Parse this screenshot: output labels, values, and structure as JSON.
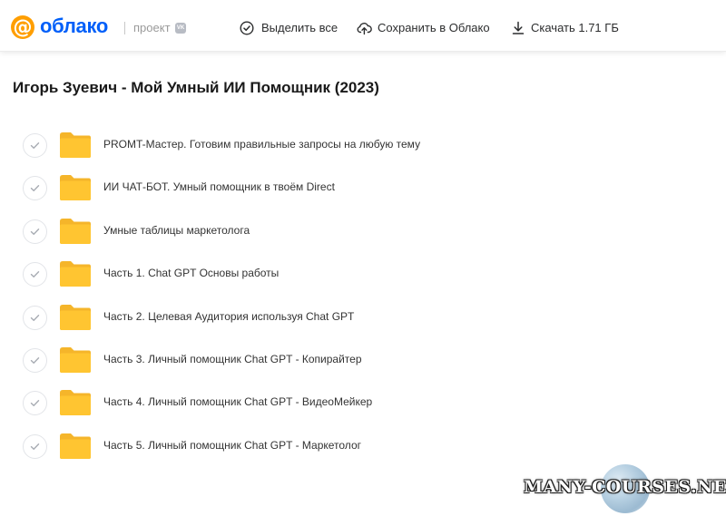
{
  "header": {
    "logo_symbol": "@",
    "logo_text": "облако",
    "logo_sub": "проект",
    "vk_badge": "VK",
    "actions": [
      {
        "label": "Выделить все",
        "icon": "check-circle-icon"
      },
      {
        "label": "Сохранить в Облако",
        "icon": "cloud-upload-icon"
      },
      {
        "label": "Скачать 1.71 ГБ",
        "icon": "download-icon"
      }
    ]
  },
  "page_title": "Игорь Зуевич - Мой Умный ИИ Помощник (2023)",
  "files": [
    {
      "name": "PROMT-Мастер. Готовим правильные запросы на любую тему",
      "type": "folder"
    },
    {
      "name": "ИИ ЧАТ-БОТ. Умный помощник в твоём Direct",
      "type": "folder"
    },
    {
      "name": "Умные таблицы маркетолога",
      "type": "folder"
    },
    {
      "name": "Часть 1. Chat GPT Основы работы",
      "type": "folder"
    },
    {
      "name": "Часть 2. Целевая Аудитория используя Chat GPT",
      "type": "folder"
    },
    {
      "name": "Часть 3. Личный помощник Chat GPT - Копирайтер",
      "type": "folder"
    },
    {
      "name": "Часть 4. Личный помощник Chat GPT - ВидеоМейкер",
      "type": "folder"
    },
    {
      "name": "Часть 5. Личный помощник Chat GPT - Маркетолог",
      "type": "folder"
    }
  ],
  "watermark": "MANY-COURSES.NET",
  "colors": {
    "logo_orange": "#ff9e00",
    "logo_blue": "#005ff9",
    "folder_yellow": "#ffc531",
    "folder_tab": "#f5b52a"
  }
}
